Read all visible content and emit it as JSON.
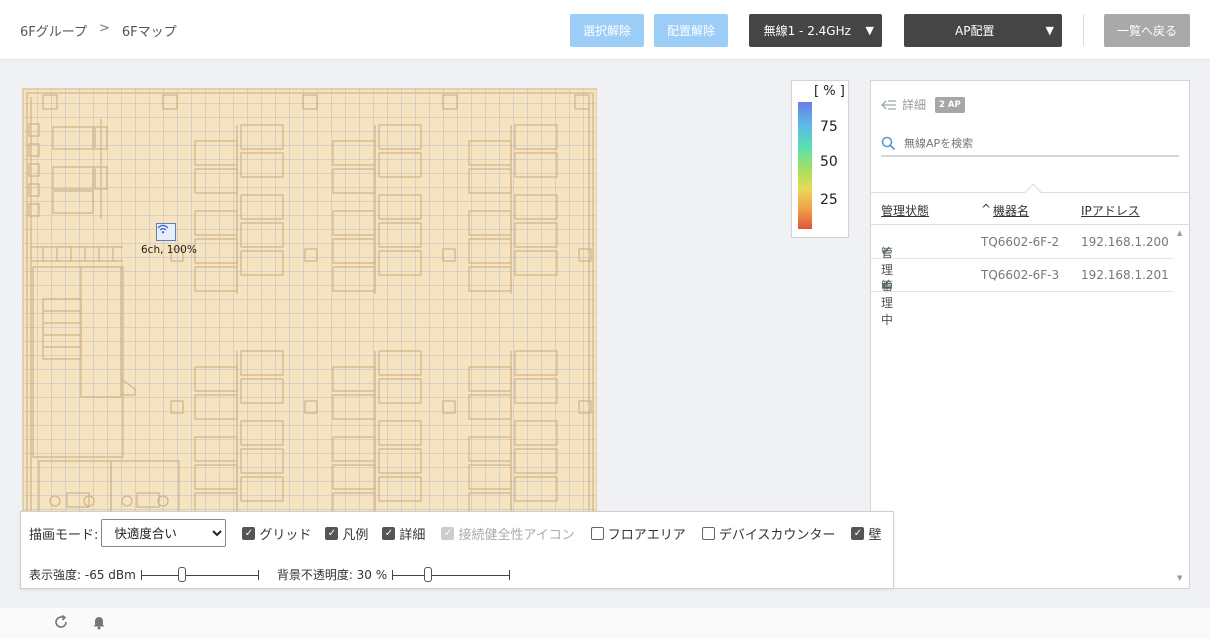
{
  "breadcrumb": [
    "6Fグループ",
    "6Fマップ"
  ],
  "breadcrumb_sep": ">",
  "header": {
    "deselect_label": "選択解除",
    "unplace_label": "配置解除",
    "band_select": "無線1 - 2.4GHz",
    "mode_select": "AP配置",
    "back_label": "一覧へ戻る",
    "dropdown_arrow": "▼"
  },
  "map": {
    "ap_label": "6ch, 100%"
  },
  "legend": {
    "unit": "[ % ]",
    "ticks": [
      "75",
      "50",
      "25"
    ],
    "colors": [
      "#6b7de8",
      "#5be0b0",
      "#e8d95b",
      "#e0553a"
    ]
  },
  "panel": {
    "title": "詳細",
    "badge": "2 AP",
    "search_placeholder": "無線APを検索",
    "columns": {
      "status": "管理状態",
      "name": "機器名",
      "ip": "IPアドレス"
    },
    "sort_indicator": "^",
    "rows": [
      {
        "status": "管理中",
        "name": "TQ6602-6F-2",
        "ip": "192.168.1.200"
      },
      {
        "status": "管理中",
        "name": "TQ6602-6F-3",
        "ip": "192.168.1.201"
      }
    ]
  },
  "controls": {
    "draw_mode_label": "描画モード:",
    "draw_mode_value": "快適度合い",
    "checkboxes": [
      {
        "label": "グリッド",
        "checked": true
      },
      {
        "label": "凡例",
        "checked": true
      },
      {
        "label": "詳細",
        "checked": true
      },
      {
        "label": "接続健全性アイコン",
        "checked": true,
        "disabled": true
      },
      {
        "label": "フロアエリア",
        "checked": false
      },
      {
        "label": "デバイスカウンター",
        "checked": false
      },
      {
        "label": "壁",
        "checked": true
      }
    ],
    "strength_label": "表示強度: -65 dBm",
    "strength_fraction": 0.35,
    "opacity_label": "背景不透明度: 30 %",
    "opacity_fraction": 0.3
  },
  "footer": {
    "refresh_icon": "refresh-icon",
    "bell_icon": "bell-icon"
  }
}
